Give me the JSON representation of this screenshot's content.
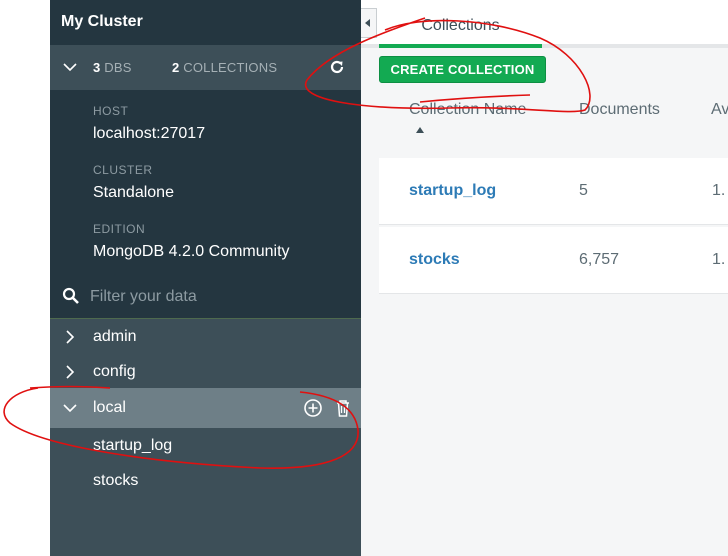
{
  "sidebar": {
    "cluster_title": "My Cluster",
    "stats": {
      "dbs_count": "3",
      "dbs_label": "DBS",
      "collections_count": "2",
      "collections_label": "COLLECTIONS"
    },
    "info": [
      {
        "label": "HOST",
        "value": "localhost:27017"
      },
      {
        "label": "CLUSTER",
        "value": "Standalone"
      },
      {
        "label": "EDITION",
        "value": "MongoDB 4.2.0 Community"
      }
    ],
    "filter_placeholder": "Filter your data",
    "databases": [
      {
        "label": "admin",
        "expanded": false
      },
      {
        "label": "config",
        "expanded": false
      },
      {
        "label": "local",
        "expanded": true,
        "collections": [
          "startup_log",
          "stocks"
        ]
      }
    ]
  },
  "main": {
    "tab_label": "Collections",
    "create_button": "CREATE COLLECTION",
    "columns": [
      "Collection Name",
      "Documents",
      "Av"
    ],
    "rows": [
      {
        "name": "startup_log",
        "documents": "5",
        "avg": "1."
      },
      {
        "name": "stocks",
        "documents": "6,757",
        "avg": "1."
      }
    ]
  },
  "colors": {
    "sidebar_dark": "#243640",
    "sidebar": "#3d4f58",
    "accent_green": "#13aa52",
    "link_blue": "#2d7bb6",
    "annotation_red": "#e01010"
  }
}
